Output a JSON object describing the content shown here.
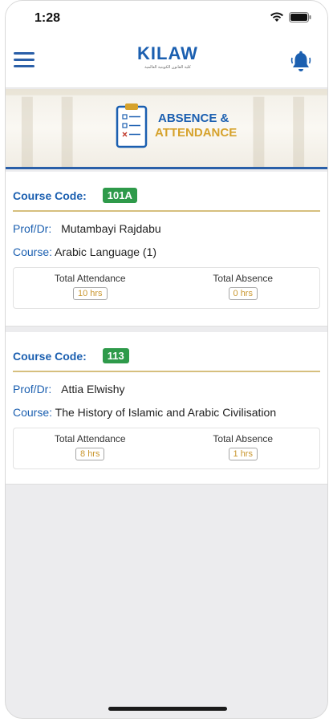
{
  "status_bar": {
    "time": "1:28"
  },
  "header": {
    "logo_text": "KILAW",
    "logo_subtitle": "كلية القانون الكويتية العالمية"
  },
  "banner": {
    "title_line1": "ABSENCE &",
    "title_line2": "ATTENDANCE"
  },
  "labels": {
    "course_code": "Course Code:",
    "prof": "Prof/Dr:",
    "course": "Course:",
    "total_attendance": "Total Attendance",
    "total_absence": "Total Absence"
  },
  "courses": [
    {
      "code": "101A",
      "professor": "Mutambayi Rajdabu",
      "course_name": "Arabic Language (1)",
      "attendance": "10 hrs",
      "absence": "0 hrs"
    },
    {
      "code": "113",
      "professor": "Attia Elwishy",
      "course_name": "The History of Islamic and Arabic Civilisation",
      "attendance": "8 hrs",
      "absence": "1 hrs"
    }
  ],
  "colors": {
    "brand_blue": "#1b5fb0",
    "accent_gold": "#d6a22c",
    "badge_green": "#2e9a4a"
  },
  "icons": [
    "menu-icon",
    "bell-icon",
    "clipboard-icon",
    "wifi-icon",
    "battery-icon"
  ]
}
